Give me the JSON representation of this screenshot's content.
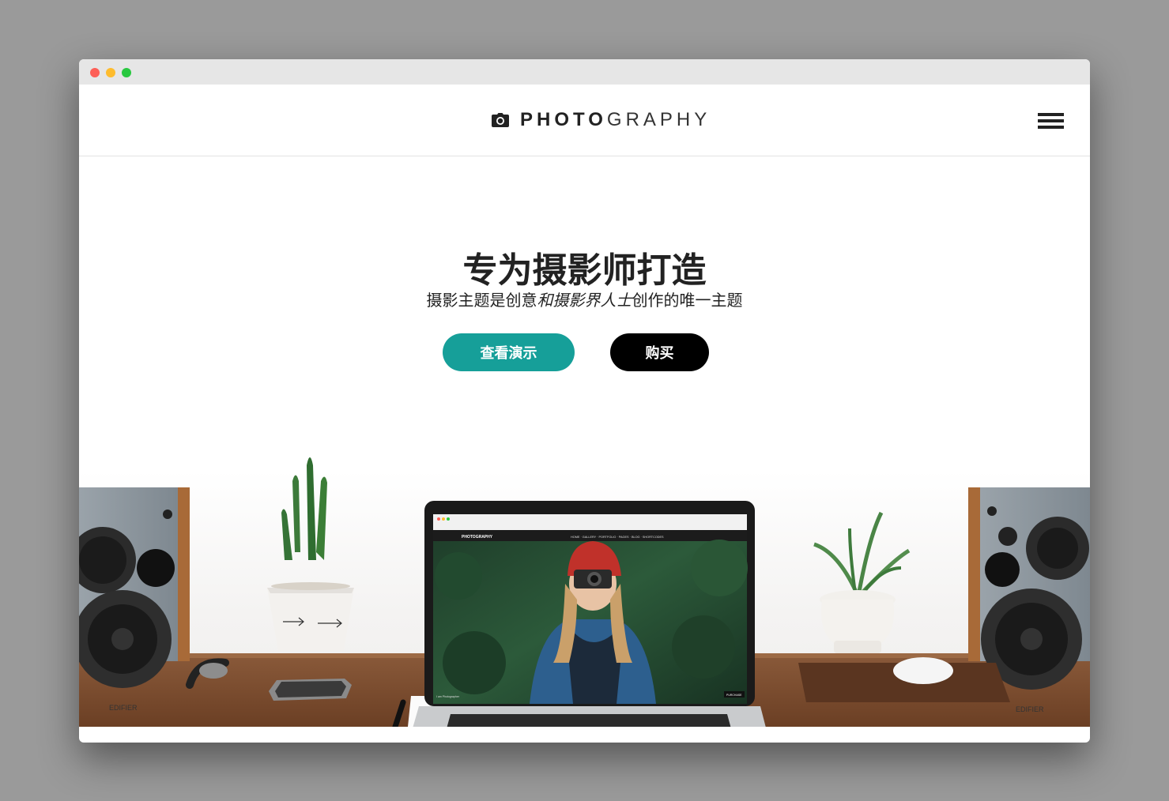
{
  "window": {
    "controls": [
      "close",
      "minimize",
      "maximize"
    ]
  },
  "header": {
    "logo_icon": "camera-icon",
    "logo_bold": "PHOTO",
    "logo_light": "GRAPHY",
    "menu_icon": "hamburger-icon"
  },
  "hero": {
    "title": "专为摄影师打造",
    "subtitle_pre": "摄影主题是创意",
    "subtitle_em": "和摄影界人士",
    "subtitle_post": "创作的唯一主题",
    "demo_button": "查看演示",
    "buy_button": "购买",
    "demo_color": "#169f99",
    "buy_color": "#000000"
  },
  "laptop_screen": {
    "site_logo": "PHOTOGRAPHY",
    "nav": [
      "HOME",
      "GALLERY",
      "PORTFOLIO",
      "PAGES",
      "BLOG",
      "SHORTCODES"
    ],
    "caption": "I am Photographer",
    "button": "PURCHASE"
  },
  "speaker_brand": "EDIFIER"
}
